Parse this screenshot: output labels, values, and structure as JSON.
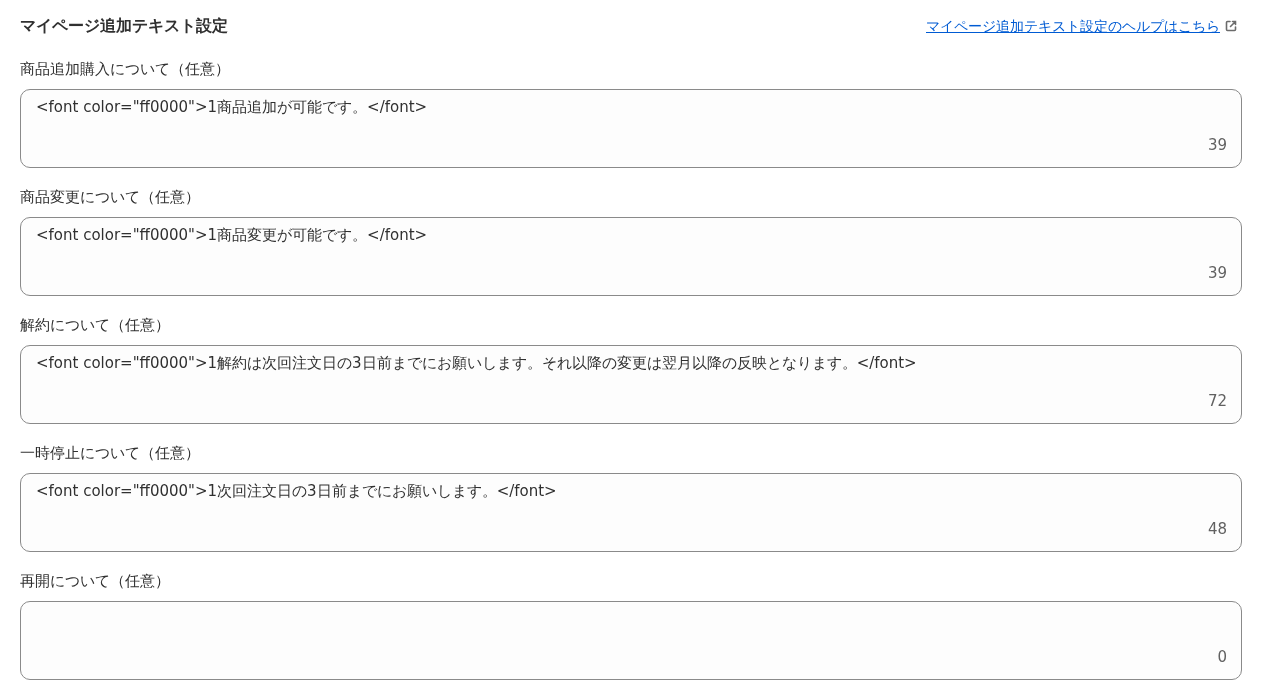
{
  "title": "マイページ追加テキスト設定",
  "help_link": {
    "text": "マイページ追加テキスト設定のヘルプはこちら"
  },
  "fields": [
    {
      "label": "商品追加購入について（任意）",
      "value": "<font color=\"ff0000\">1商品追加が可能です。</font>",
      "count": "39"
    },
    {
      "label": "商品変更について（任意）",
      "value": "<font color=\"ff0000\">1商品変更が可能です。</font>",
      "count": "39"
    },
    {
      "label": "解約について（任意）",
      "value": "<font color=\"ff0000\">1解約は次回注文日の3日前までにお願いします。それ以降の変更は翌月以降の反映となります。</font>",
      "count": "72"
    },
    {
      "label": "一時停止について（任意）",
      "value": "<font color=\"ff0000\">1次回注文日の3日前までにお願いします。</font>",
      "count": "48"
    },
    {
      "label": "再開について（任意）",
      "count": "0"
    }
  ]
}
